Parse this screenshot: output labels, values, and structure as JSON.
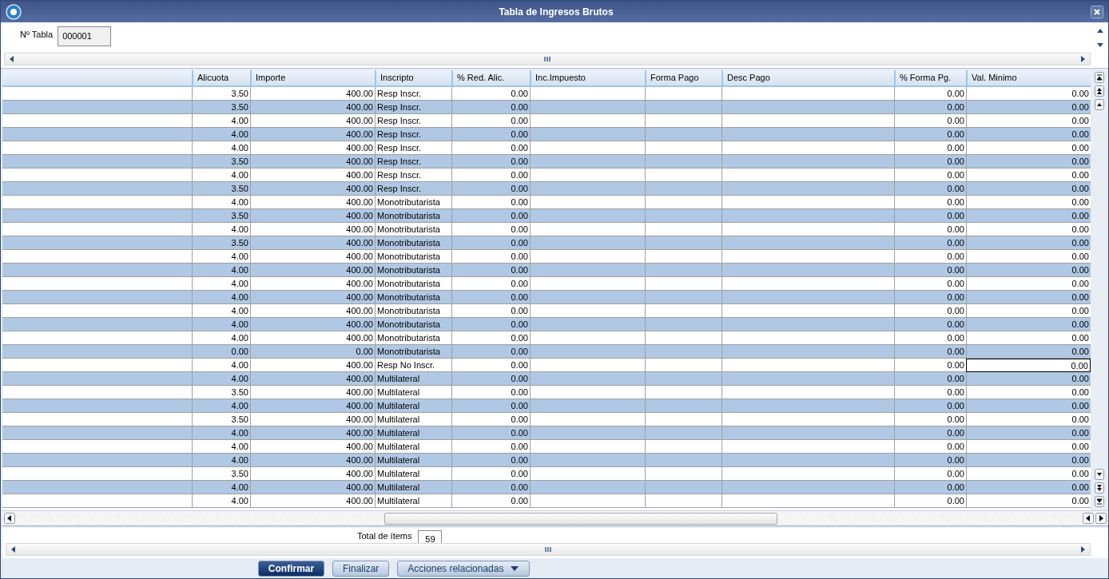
{
  "window": {
    "title": "Tabla de Ingresos Brutos"
  },
  "header": {
    "field_label": "Nº Tabla",
    "field_value": "000001"
  },
  "table": {
    "columns": [
      "Alicuota",
      "Importe",
      "Inscripto",
      "% Red. Alic.",
      "Inc.Impuesto",
      "Forma Pago",
      "Desc Pago",
      "% Forma Pg.",
      "Val. Minimo"
    ],
    "rows": [
      {
        "alicuota": "3.50",
        "importe": "400.00",
        "inscripto": "Resp Inscr.",
        "red_alic": "0.00",
        "forma_pg": "0.00",
        "val_minimo": "0.00",
        "selected": false
      },
      {
        "alicuota": "3.50",
        "importe": "400.00",
        "inscripto": "Resp Inscr.",
        "red_alic": "0.00",
        "forma_pg": "0.00",
        "val_minimo": "0.00",
        "selected": false
      },
      {
        "alicuota": "4.00",
        "importe": "400.00",
        "inscripto": "Resp Inscr.",
        "red_alic": "0.00",
        "forma_pg": "0.00",
        "val_minimo": "0.00",
        "selected": false
      },
      {
        "alicuota": "4.00",
        "importe": "400.00",
        "inscripto": "Resp Inscr.",
        "red_alic": "0.00",
        "forma_pg": "0.00",
        "val_minimo": "0.00",
        "selected": false
      },
      {
        "alicuota": "4.00",
        "importe": "400.00",
        "inscripto": "Resp Inscr.",
        "red_alic": "0.00",
        "forma_pg": "0.00",
        "val_minimo": "0.00",
        "selected": false
      },
      {
        "alicuota": "3.50",
        "importe": "400.00",
        "inscripto": "Resp Inscr.",
        "red_alic": "0.00",
        "forma_pg": "0.00",
        "val_minimo": "0.00",
        "selected": false
      },
      {
        "alicuota": "4.00",
        "importe": "400.00",
        "inscripto": "Resp Inscr.",
        "red_alic": "0.00",
        "forma_pg": "0.00",
        "val_minimo": "0.00",
        "selected": false
      },
      {
        "alicuota": "3.50",
        "importe": "400.00",
        "inscripto": "Resp Inscr.",
        "red_alic": "0.00",
        "forma_pg": "0.00",
        "val_minimo": "0.00",
        "selected": false
      },
      {
        "alicuota": "4.00",
        "importe": "400.00",
        "inscripto": "Monotributarista",
        "red_alic": "0.00",
        "forma_pg": "0.00",
        "val_minimo": "0.00",
        "selected": false
      },
      {
        "alicuota": "3.50",
        "importe": "400.00",
        "inscripto": "Monotributarista",
        "red_alic": "0.00",
        "forma_pg": "0.00",
        "val_minimo": "0.00",
        "selected": false
      },
      {
        "alicuota": "4.00",
        "importe": "400.00",
        "inscripto": "Monotributarista",
        "red_alic": "0.00",
        "forma_pg": "0.00",
        "val_minimo": "0.00",
        "selected": false
      },
      {
        "alicuota": "3.50",
        "importe": "400.00",
        "inscripto": "Monotributarista",
        "red_alic": "0.00",
        "forma_pg": "0.00",
        "val_minimo": "0.00",
        "selected": false
      },
      {
        "alicuota": "4.00",
        "importe": "400.00",
        "inscripto": "Monotributarista",
        "red_alic": "0.00",
        "forma_pg": "0.00",
        "val_minimo": "0.00",
        "selected": false
      },
      {
        "alicuota": "4.00",
        "importe": "400.00",
        "inscripto": "Monotributarista",
        "red_alic": "0.00",
        "forma_pg": "0.00",
        "val_minimo": "0.00",
        "selected": false
      },
      {
        "alicuota": "4.00",
        "importe": "400.00",
        "inscripto": "Monotributarista",
        "red_alic": "0.00",
        "forma_pg": "0.00",
        "val_minimo": "0.00",
        "selected": false
      },
      {
        "alicuota": "4.00",
        "importe": "400.00",
        "inscripto": "Monotributarista",
        "red_alic": "0.00",
        "forma_pg": "0.00",
        "val_minimo": "0.00",
        "selected": false
      },
      {
        "alicuota": "4.00",
        "importe": "400.00",
        "inscripto": "Monotributarista",
        "red_alic": "0.00",
        "forma_pg": "0.00",
        "val_minimo": "0.00",
        "selected": false
      },
      {
        "alicuota": "4.00",
        "importe": "400.00",
        "inscripto": "Monotributarista",
        "red_alic": "0.00",
        "forma_pg": "0.00",
        "val_minimo": "0.00",
        "selected": false
      },
      {
        "alicuota": "4.00",
        "importe": "400.00",
        "inscripto": "Monotributarista",
        "red_alic": "0.00",
        "forma_pg": "0.00",
        "val_minimo": "0.00",
        "selected": false
      },
      {
        "alicuota": "0.00",
        "importe": "0.00",
        "inscripto": "Monotributarista",
        "red_alic": "0.00",
        "forma_pg": "0.00",
        "val_minimo": "0.00",
        "selected": false
      },
      {
        "alicuota": "4.00",
        "importe": "400.00",
        "inscripto": "Resp No Inscr.",
        "red_alic": "0.00",
        "forma_pg": "0.00",
        "val_minimo": "0.00",
        "selected": true
      },
      {
        "alicuota": "4.00",
        "importe": "400.00",
        "inscripto": "Multilateral",
        "red_alic": "0.00",
        "forma_pg": "0.00",
        "val_minimo": "0.00",
        "selected": false
      },
      {
        "alicuota": "3.50",
        "importe": "400.00",
        "inscripto": "Multilateral",
        "red_alic": "0.00",
        "forma_pg": "0.00",
        "val_minimo": "0.00",
        "selected": false
      },
      {
        "alicuota": "4.00",
        "importe": "400.00",
        "inscripto": "Multilateral",
        "red_alic": "0.00",
        "forma_pg": "0.00",
        "val_minimo": "0.00",
        "selected": false
      },
      {
        "alicuota": "3.50",
        "importe": "400.00",
        "inscripto": "Multilateral",
        "red_alic": "0.00",
        "forma_pg": "0.00",
        "val_minimo": "0.00",
        "selected": false
      },
      {
        "alicuota": "4.00",
        "importe": "400.00",
        "inscripto": "Multilateral",
        "red_alic": "0.00",
        "forma_pg": "0.00",
        "val_minimo": "0.00",
        "selected": false
      },
      {
        "alicuota": "4.00",
        "importe": "400.00",
        "inscripto": "Multilateral",
        "red_alic": "0.00",
        "forma_pg": "0.00",
        "val_minimo": "0.00",
        "selected": false
      },
      {
        "alicuota": "4.00",
        "importe": "400.00",
        "inscripto": "Multilateral",
        "red_alic": "0.00",
        "forma_pg": "0.00",
        "val_minimo": "0.00",
        "selected": false
      },
      {
        "alicuota": "3.50",
        "importe": "400.00",
        "inscripto": "Multilateral",
        "red_alic": "0.00",
        "forma_pg": "0.00",
        "val_minimo": "0.00",
        "selected": false
      },
      {
        "alicuota": "4.00",
        "importe": "400.00",
        "inscripto": "Multilateral",
        "red_alic": "0.00",
        "forma_pg": "0.00",
        "val_minimo": "0.00",
        "selected": false
      },
      {
        "alicuota": "4.00",
        "importe": "400.00",
        "inscripto": "Multilateral",
        "red_alic": "0.00",
        "forma_pg": "0.00",
        "val_minimo": "0.00",
        "selected": false
      }
    ]
  },
  "footer": {
    "total_label": "Total de ítems",
    "total_value": "59"
  },
  "buttons": [
    {
      "label": "Confirmar",
      "kind": "primary"
    },
    {
      "label": "Finalizar",
      "kind": "secondary"
    },
    {
      "label": "Acciones relacionadas",
      "kind": "dropdown"
    }
  ]
}
